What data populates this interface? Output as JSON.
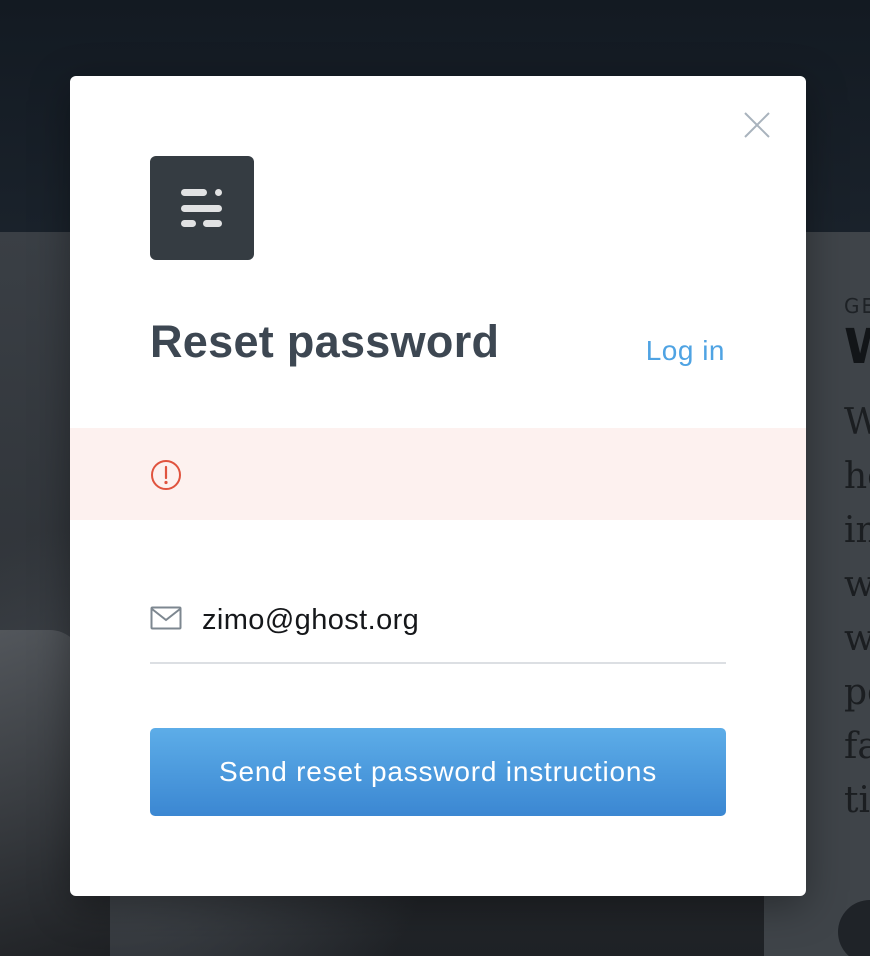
{
  "background": {
    "tag_fragment": "GE",
    "title_fragment": "W",
    "text_lines": [
      "W",
      "he",
      "in",
      "w",
      "w",
      "pe",
      "fa",
      "ti"
    ]
  },
  "modal": {
    "title": "Reset password",
    "login_link": "Log in",
    "alert": {
      "icon": "alert-circle-icon",
      "message": ""
    },
    "email": {
      "value": "zimo@ghost.org",
      "placeholder": "",
      "icon": "mail-icon"
    },
    "submit_label": "Send reset password instructions",
    "close_icon": "close-icon",
    "logo_icon": "ghost-logo-icon"
  },
  "colors": {
    "accent": "#4fa3e3",
    "button_top": "#5dade8",
    "button_bottom": "#3b87d2",
    "alert_bg": "#fdf1ef",
    "alert_red": "#e0533e",
    "title": "#3d4752",
    "logo_bg": "#353c42"
  }
}
